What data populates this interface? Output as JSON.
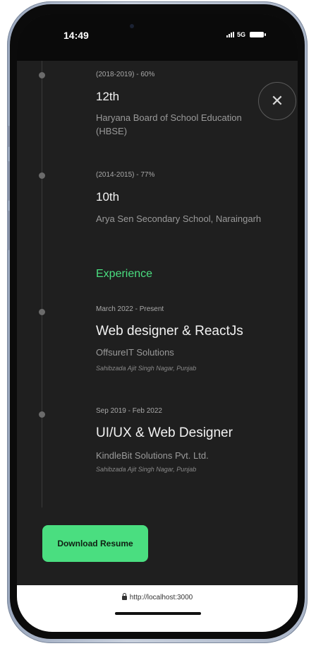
{
  "status_bar": {
    "time": "14:49",
    "network": "5G"
  },
  "education": [
    {
      "date": "(2018-2019) - 60%",
      "title": "12th",
      "institution": "Haryana Board of School Education (HBSE)"
    },
    {
      "date": "(2014-2015) - 77%",
      "title": "10th",
      "institution": "Arya Sen Secondary School, Naraingarh"
    }
  ],
  "experience_heading": "Experience",
  "experience": [
    {
      "date": "March 2022 - Present",
      "title": "Web designer & ReactJs",
      "company": "OffsureIT Solutions",
      "location": "Sahibzada Ajit Singh Nagar, Punjab"
    },
    {
      "date": "Sep 2019 - Feb 2022",
      "title": "UI/UX & Web Designer",
      "company": "KindleBit Solutions Pvt. Ltd.",
      "location": "Sahibzada Ajit Singh Nagar, Punjab"
    }
  ],
  "close_button": {
    "glyph": "✕"
  },
  "download_button": {
    "label": "Download Resume"
  },
  "browser": {
    "url": "http://localhost:3000"
  },
  "colors": {
    "accent": "#4ade80",
    "background": "#1f1f1f"
  }
}
